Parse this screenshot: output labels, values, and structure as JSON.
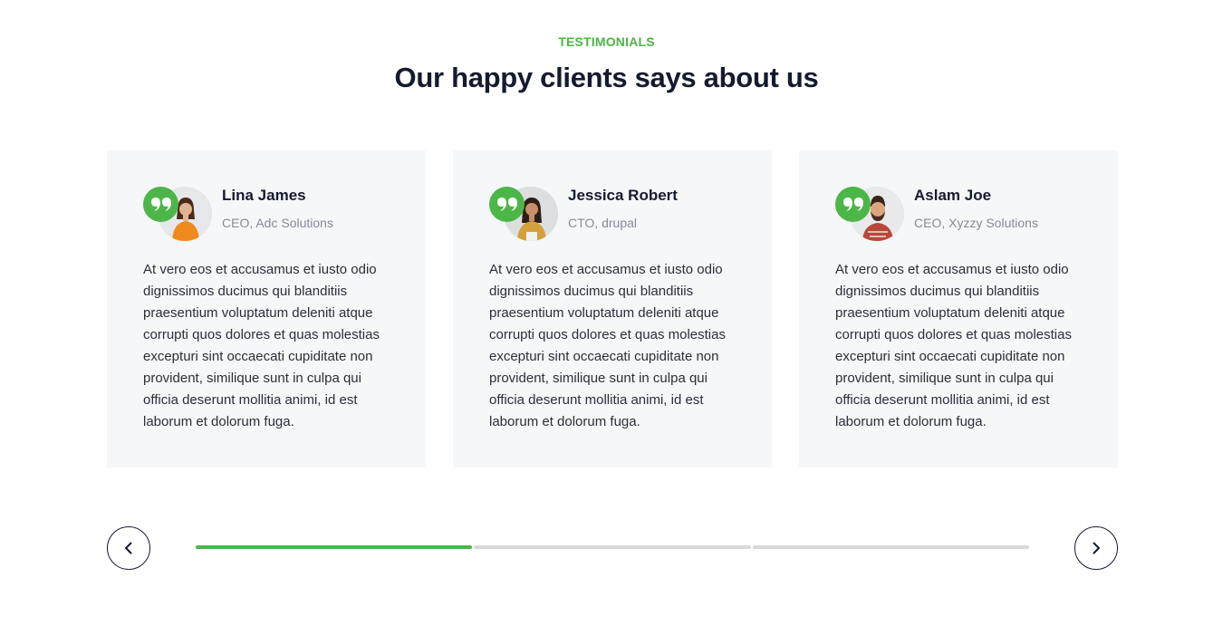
{
  "section": {
    "eyebrow": "TESTIMONIALS",
    "heading": "Our happy clients says about us"
  },
  "testimonials": [
    {
      "name": "Lina James",
      "role": "CEO, Adc Solutions",
      "quote": "At vero eos et accusamus et iusto odio dignissimos ducimus qui blanditiis praesentium voluptatum deleniti atque corrupti quos dolores et quas molestias excepturi sint occaecati cupiditate non provident, similique sunt in culpa qui officia deserunt mollitia animi, id est laborum et dolorum fuga."
    },
    {
      "name": "Jessica Robert",
      "role": "CTO, drupal",
      "quote": "At vero eos et accusamus et iusto odio dignissimos ducimus qui blanditiis praesentium voluptatum deleniti atque corrupti quos dolores et quas molestias excepturi sint occaecati cupiditate non provident, similique sunt in culpa qui officia deserunt mollitia animi, id est laborum et dolorum fuga."
    },
    {
      "name": "Aslam Joe",
      "role": "CEO, Xyzzy Solutions",
      "quote": "At vero eos et accusamus et iusto odio dignissimos ducimus qui blanditiis praesentium voluptatum deleniti atque corrupti quos dolores et quas molestias excepturi sint occaecati cupiditate non provident, similique sunt in culpa qui officia deserunt mollitia animi, id est laborum et dolorum fuga."
    }
  ],
  "slider": {
    "prev_icon": "chevron-left-icon",
    "next_icon": "chevron-right-icon",
    "progress_segments": 3,
    "active_segment": 1
  },
  "colors": {
    "accent": "#4cb648",
    "heading": "#151b2e",
    "card_bg": "#f6f7f9",
    "track": "#d9d9d9"
  }
}
